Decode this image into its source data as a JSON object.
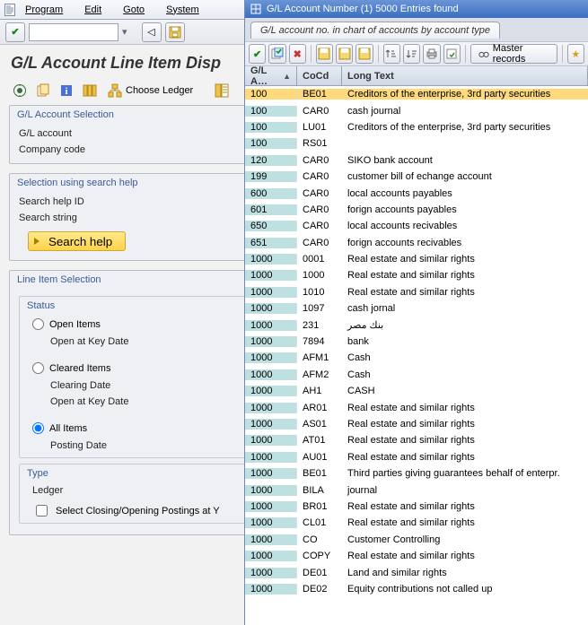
{
  "menubar": {
    "items": [
      "Program",
      "Edit",
      "Goto",
      "System"
    ]
  },
  "page_title": "G/L Account Line Item Disp",
  "toolbar2": {
    "choose_ledger": "Choose Ledger"
  },
  "group_gl": {
    "title": "G/L Account Selection",
    "gl_account_label": "G/L account",
    "company_code_label": "Company code"
  },
  "group_search": {
    "title": "Selection using search help",
    "help_id_label": "Search help ID",
    "search_string_label": "Search string",
    "button_label": "Search help"
  },
  "group_line": {
    "title": "Line Item Selection",
    "status_title": "Status",
    "open_items_label": "Open Items",
    "open_keydate_label": "Open at Key Date",
    "cleared_items_label": "Cleared Items",
    "clearing_date_label": "Clearing Date",
    "open_keydate2_label": "Open at Key Date",
    "all_items_label": "All Items",
    "posting_date_label": "Posting Date",
    "type_title": "Type",
    "ledger_label": "Ledger",
    "closing_label": "Select Closing/Opening Postings at Y"
  },
  "popup": {
    "title": "G/L Account Number (1) 5000 Entries found",
    "tab_label": "G/L account no. in chart of accounts by account type",
    "master_records_label": "Master records",
    "columns": {
      "gl": "G/L A…",
      "cocd": "CoCd",
      "long": "Long Text"
    },
    "rows": [
      {
        "gl": "100",
        "cocd": "BE01",
        "txt": "Creditors of the enterprise, 3rd party securities",
        "sel": true
      },
      {
        "gl": "100",
        "cocd": "CAR0",
        "txt": "cash journal"
      },
      {
        "gl": "100",
        "cocd": "LU01",
        "txt": "Creditors of the enterprise, 3rd party securities"
      },
      {
        "gl": "100",
        "cocd": "RS01",
        "txt": ""
      },
      {
        "gl": "120",
        "cocd": "CAR0",
        "txt": "SIKO bank account"
      },
      {
        "gl": "199",
        "cocd": "CAR0",
        "txt": "customer bill of echange account"
      },
      {
        "gl": "600",
        "cocd": "CAR0",
        "txt": "local accounts payables"
      },
      {
        "gl": "601",
        "cocd": "CAR0",
        "txt": "forign accounts payables"
      },
      {
        "gl": "650",
        "cocd": "CAR0",
        "txt": "local accounts recivables"
      },
      {
        "gl": "651",
        "cocd": "CAR0",
        "txt": "forign accounts recivables"
      },
      {
        "gl": "1000",
        "cocd": "0001",
        "txt": "Real estate and similar rights"
      },
      {
        "gl": "1000",
        "cocd": "1000",
        "txt": "Real estate and similar rights"
      },
      {
        "gl": "1000",
        "cocd": "1010",
        "txt": "Real estate and similar rights"
      },
      {
        "gl": "1000",
        "cocd": "1097",
        "txt": "cash jornal"
      },
      {
        "gl": "1000",
        "cocd": "231",
        "txt": "بنك مصر"
      },
      {
        "gl": "1000",
        "cocd": "7894",
        "txt": "bank"
      },
      {
        "gl": "1000",
        "cocd": "AFM1",
        "txt": "Cash"
      },
      {
        "gl": "1000",
        "cocd": "AFM2",
        "txt": "Cash"
      },
      {
        "gl": "1000",
        "cocd": "AH1",
        "txt": "CASH"
      },
      {
        "gl": "1000",
        "cocd": "AR01",
        "txt": "Real estate and similar rights"
      },
      {
        "gl": "1000",
        "cocd": "AS01",
        "txt": "Real estate and similar rights"
      },
      {
        "gl": "1000",
        "cocd": "AT01",
        "txt": "Real estate and similar rights"
      },
      {
        "gl": "1000",
        "cocd": "AU01",
        "txt": "Real estate and similar rights"
      },
      {
        "gl": "1000",
        "cocd": "BE01",
        "txt": "Third parties giving guarantees behalf of enterpr."
      },
      {
        "gl": "1000",
        "cocd": "BILA",
        "txt": "journal"
      },
      {
        "gl": "1000",
        "cocd": "BR01",
        "txt": "Real estate and similar rights"
      },
      {
        "gl": "1000",
        "cocd": "CL01",
        "txt": "Real estate and similar rights"
      },
      {
        "gl": "1000",
        "cocd": "CO",
        "txt": "Customer Controlling"
      },
      {
        "gl": "1000",
        "cocd": "COPY",
        "txt": "Real estate and similar rights"
      },
      {
        "gl": "1000",
        "cocd": "DE01",
        "txt": "Land and similar rights"
      },
      {
        "gl": "1000",
        "cocd": "DE02",
        "txt": "Equity contributions not called up"
      }
    ]
  }
}
